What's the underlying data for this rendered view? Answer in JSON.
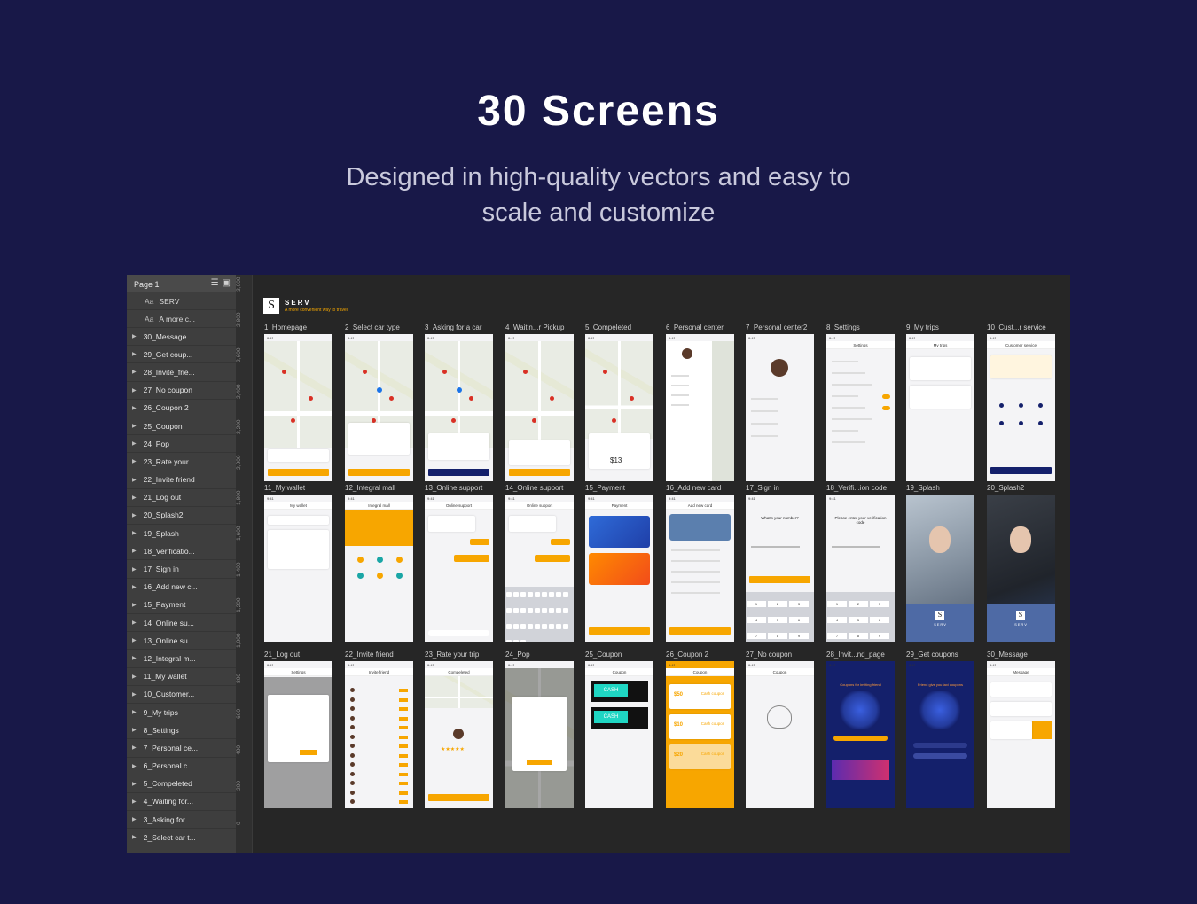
{
  "hero": {
    "title": "30 Screens",
    "subtitle": "Designed in high-quality vectors and easy to scale and customize"
  },
  "layers_panel": {
    "page": "Page 1",
    "text_layers": [
      "SERV",
      "A more c..."
    ],
    "items": [
      "30_Message",
      "29_Get coup...",
      "28_Invite_frie...",
      "27_No coupon",
      "26_Coupon 2",
      "25_Coupon",
      "24_Pop",
      "23_Rate your...",
      "22_Invite friend",
      "21_Log out",
      "20_Splash2",
      "19_Splash",
      "18_Verificatio...",
      "17_Sign in",
      "16_Add new c...",
      "15_Payment",
      "14_Online su...",
      "13_Online su...",
      "12_Integral m...",
      "11_My wallet",
      "10_Customer...",
      "9_My trips",
      "8_Settings",
      "7_Personal ce...",
      "6_Personal c...",
      "5_Compeleted",
      "4_Waiting for...",
      "3_Asking for...",
      "2_Select car t...",
      "1_Homepage"
    ]
  },
  "ruler": [
    "-3,000",
    "-2,800",
    "-2,600",
    "-2,400",
    "-2,200",
    "-2,000",
    "-1,800",
    "-1,600",
    "-1,400",
    "-1,200",
    "-1,000",
    "-800",
    "-600",
    "-400",
    "-200",
    "0"
  ],
  "brand": {
    "logo": "S",
    "name": "SERV",
    "tagline": "A more convenient way to travel"
  },
  "screens": {
    "row1": [
      "1_Homepage",
      "2_Select car type",
      "3_Asking for a car",
      "4_Waitin...r Pickup",
      "5_Compeleted",
      "6_Personal center",
      "7_Personal center2",
      "8_Settings",
      "9_My trips",
      "10_Cust...r service"
    ],
    "row2": [
      "11_My wallet",
      "12_Integral mall",
      "13_Online support",
      "14_Online support",
      "15_Payment",
      "16_Add new card",
      "17_Sign in",
      "18_Verifi...ion code",
      "19_Splash",
      "20_Splash2"
    ],
    "row3": [
      "21_Log out",
      "22_Invite friend",
      "23_Rate your trip",
      "24_Pop",
      "25_Coupon",
      "26_Coupon 2",
      "27_No coupon",
      "28_Invit...nd_page",
      "29_Get coupons",
      "30_Message"
    ]
  },
  "screen_text": {
    "completed": "Compeleted",
    "fare": "$13",
    "my_wallet": "My wallet",
    "integral_mall": "Integral mall",
    "online_support": "Online support",
    "payment": "Payment",
    "add_new_card": "Add new card",
    "sign_in_q": "What's your number?",
    "verify_q": "Please enter your verification code",
    "settings": "Settings",
    "invite_friend": "Invite friend",
    "coupon": "Coupon",
    "cash": "CASH",
    "c50": "$50",
    "c10": "$10",
    "c20": "$20",
    "cash_coupon": "Cash coupon",
    "message": "Message",
    "my_trips": "My trips",
    "customer_service": "Customer service",
    "invite_coupons": "Coupons for inviting friend",
    "friend_give": "Friend give you taxi coupons",
    "serv": "SERV"
  },
  "colors": {
    "bg": "#181848",
    "accent": "#f7a600",
    "navy": "#14206b",
    "panel": "#3e3e3e"
  }
}
